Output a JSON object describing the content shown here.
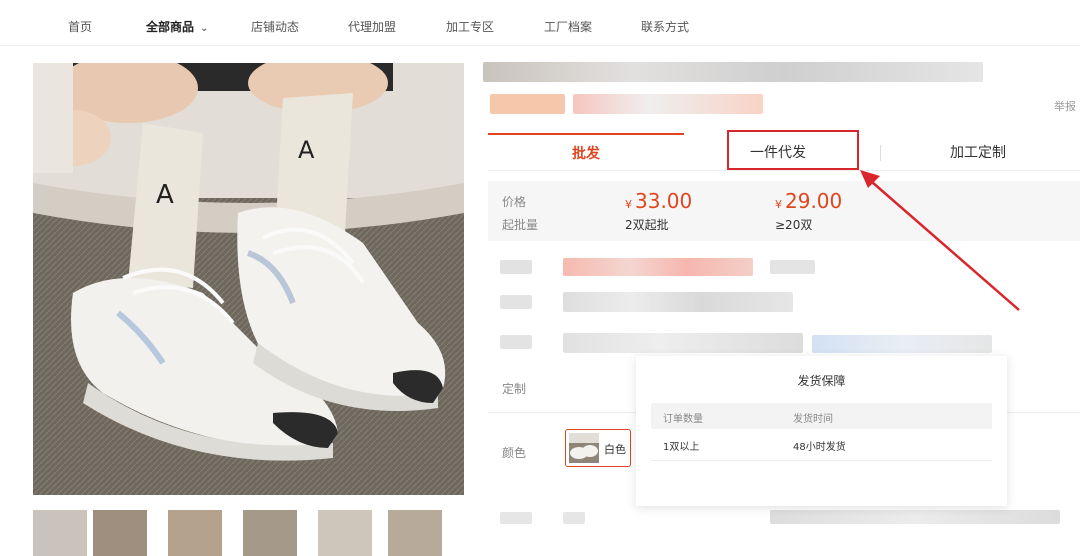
{
  "nav": {
    "items": [
      {
        "label": "首页"
      },
      {
        "label": "全部商品"
      },
      {
        "label": "店铺动态"
      },
      {
        "label": "代理加盟"
      },
      {
        "label": "加工专区"
      },
      {
        "label": "工厂档案"
      },
      {
        "label": "联系方式"
      }
    ],
    "active_index": 1
  },
  "report_label": "举报",
  "tabs": [
    {
      "label": "批发"
    },
    {
      "label": "一件代发"
    },
    {
      "label": "加工定制"
    }
  ],
  "active_tab": "批发",
  "highlighted_tab": "一件代发",
  "pricing": {
    "price_label": "价格",
    "min_order_label": "起批量",
    "currency": "¥",
    "tiers": [
      {
        "price": "33.00",
        "quantity": "2双起批"
      },
      {
        "price": "29.00",
        "quantity": "≥20双"
      }
    ]
  },
  "customize_label": "定制",
  "color_label": "颜色",
  "color_option": "白色",
  "shipping_popup": {
    "title": "发货保障",
    "columns": [
      "订单数量",
      "发货时间"
    ],
    "rows": [
      {
        "quantity": "1双以上",
        "time": "48小时发货"
      }
    ]
  },
  "colors": {
    "accent": "#e0451f",
    "annotation": "#d9262d"
  }
}
